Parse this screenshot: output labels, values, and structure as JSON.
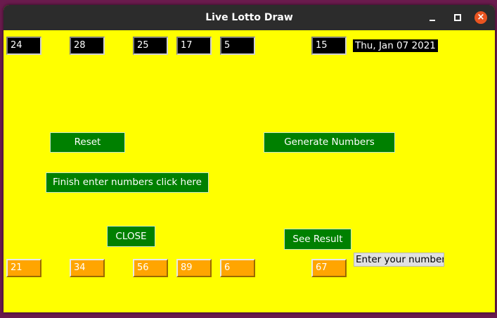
{
  "window": {
    "title": "Live Lotto Draw",
    "minimize_glyph": "–",
    "maximize_glyph": "□",
    "close_glyph": "×"
  },
  "colors": {
    "background": "#ffff00",
    "button": "#008000",
    "drawn_box": "#000000",
    "entry_box": "#ffa500",
    "close_circle": "#e95420"
  },
  "drawn_numbers": [
    "24",
    "28",
    "25",
    "17",
    "5",
    "15"
  ],
  "date": "Thu, Jan 07 2021",
  "buttons": {
    "reset": "Reset",
    "generate": "Generate Numbers",
    "finish": "Finish enter numbers click here",
    "close": "CLOSE",
    "see_result": "See Result"
  },
  "entered_numbers": [
    "21",
    "34",
    "56",
    "89",
    "6",
    "67"
  ],
  "entry_label": "Enter your  number"
}
